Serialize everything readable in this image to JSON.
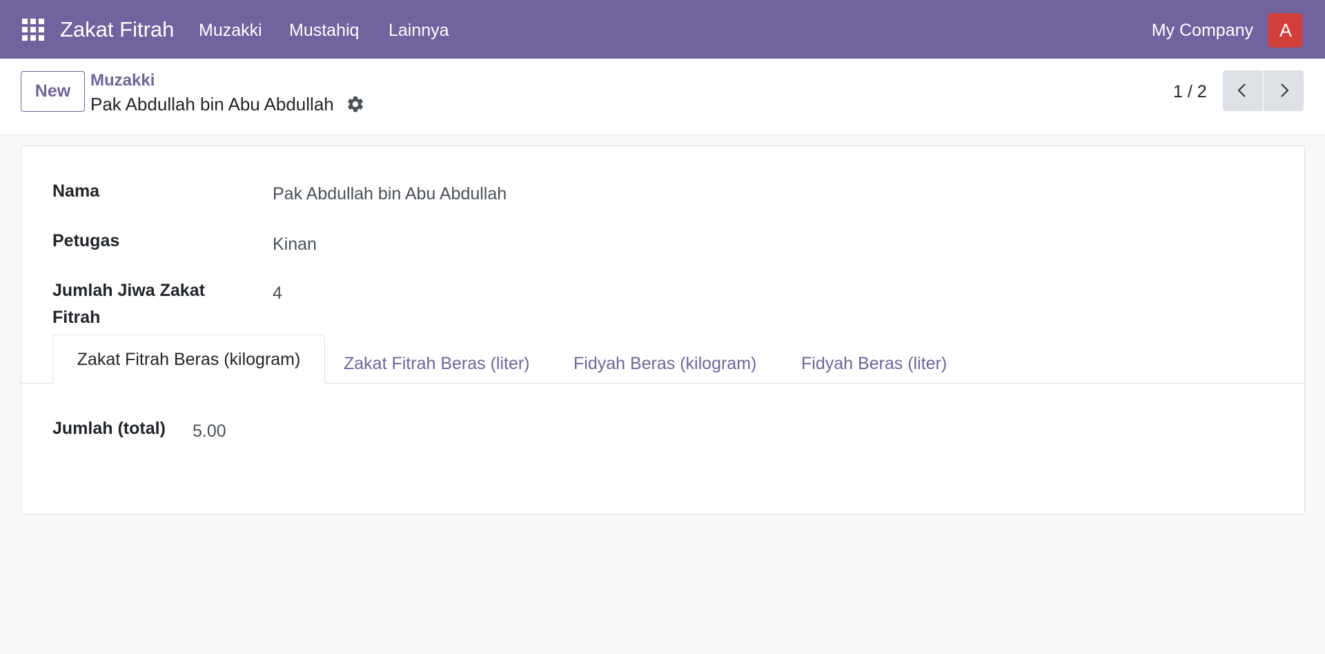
{
  "navbar": {
    "app_title": "Zakat Fitrah",
    "menu": [
      "Muzakki",
      "Mustahiq",
      "Lainnya"
    ],
    "company": "My Company",
    "avatar_letter": "A",
    "background_color": "#71639e",
    "avatar_color": "#d23f3a"
  },
  "control_panel": {
    "new_button": "New",
    "breadcrumb": "Muzakki",
    "record_title": "Pak Abdullah bin Abu Abdullah",
    "pager": "1 / 2"
  },
  "form": {
    "fields": [
      {
        "label": "Nama",
        "value": "Pak Abdullah bin Abu Abdullah"
      },
      {
        "label": "Petugas",
        "value": "Kinan"
      },
      {
        "label": "Jumlah Jiwa Zakat Fitrah",
        "value": "4"
      }
    ],
    "tabs": [
      {
        "label": "Zakat Fitrah Beras (kilogram)",
        "active": true
      },
      {
        "label": "Zakat Fitrah Beras (liter)",
        "active": false
      },
      {
        "label": "Fidyah Beras (kilogram)",
        "active": false
      },
      {
        "label": "Fidyah Beras (liter)",
        "active": false
      }
    ],
    "tab_content": {
      "label": "Jumlah (total)",
      "value": "5.00"
    }
  },
  "icons": {
    "apps": "apps-grid-icon",
    "settings": "gear-icon",
    "prev": "chevron-left-icon",
    "next": "chevron-right-icon"
  }
}
